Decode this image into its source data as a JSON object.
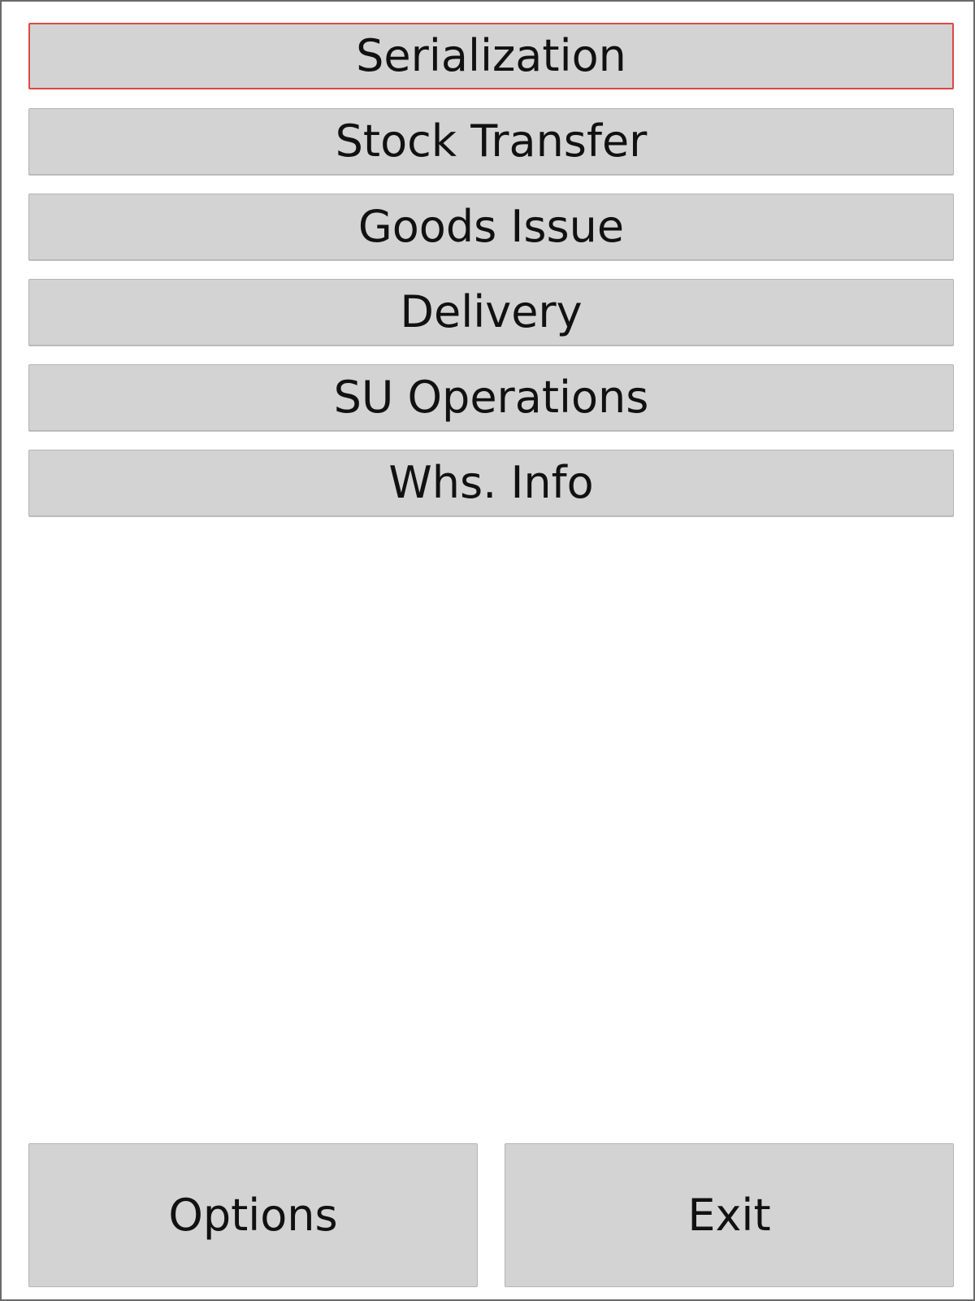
{
  "menu": {
    "items": [
      {
        "label": "Serialization"
      },
      {
        "label": "Stock Transfer"
      },
      {
        "label": "Goods Issue"
      },
      {
        "label": "Delivery"
      },
      {
        "label": "SU Operations"
      },
      {
        "label": "Whs. Info"
      }
    ],
    "focused_index": 0,
    "focus_color": "#e04747"
  },
  "footer": {
    "options_label": "Options",
    "exit_label": "Exit"
  },
  "colors": {
    "button_background": "#d3d3d3",
    "window_background": "#ffffff",
    "window_border": "#6a6a6a"
  }
}
